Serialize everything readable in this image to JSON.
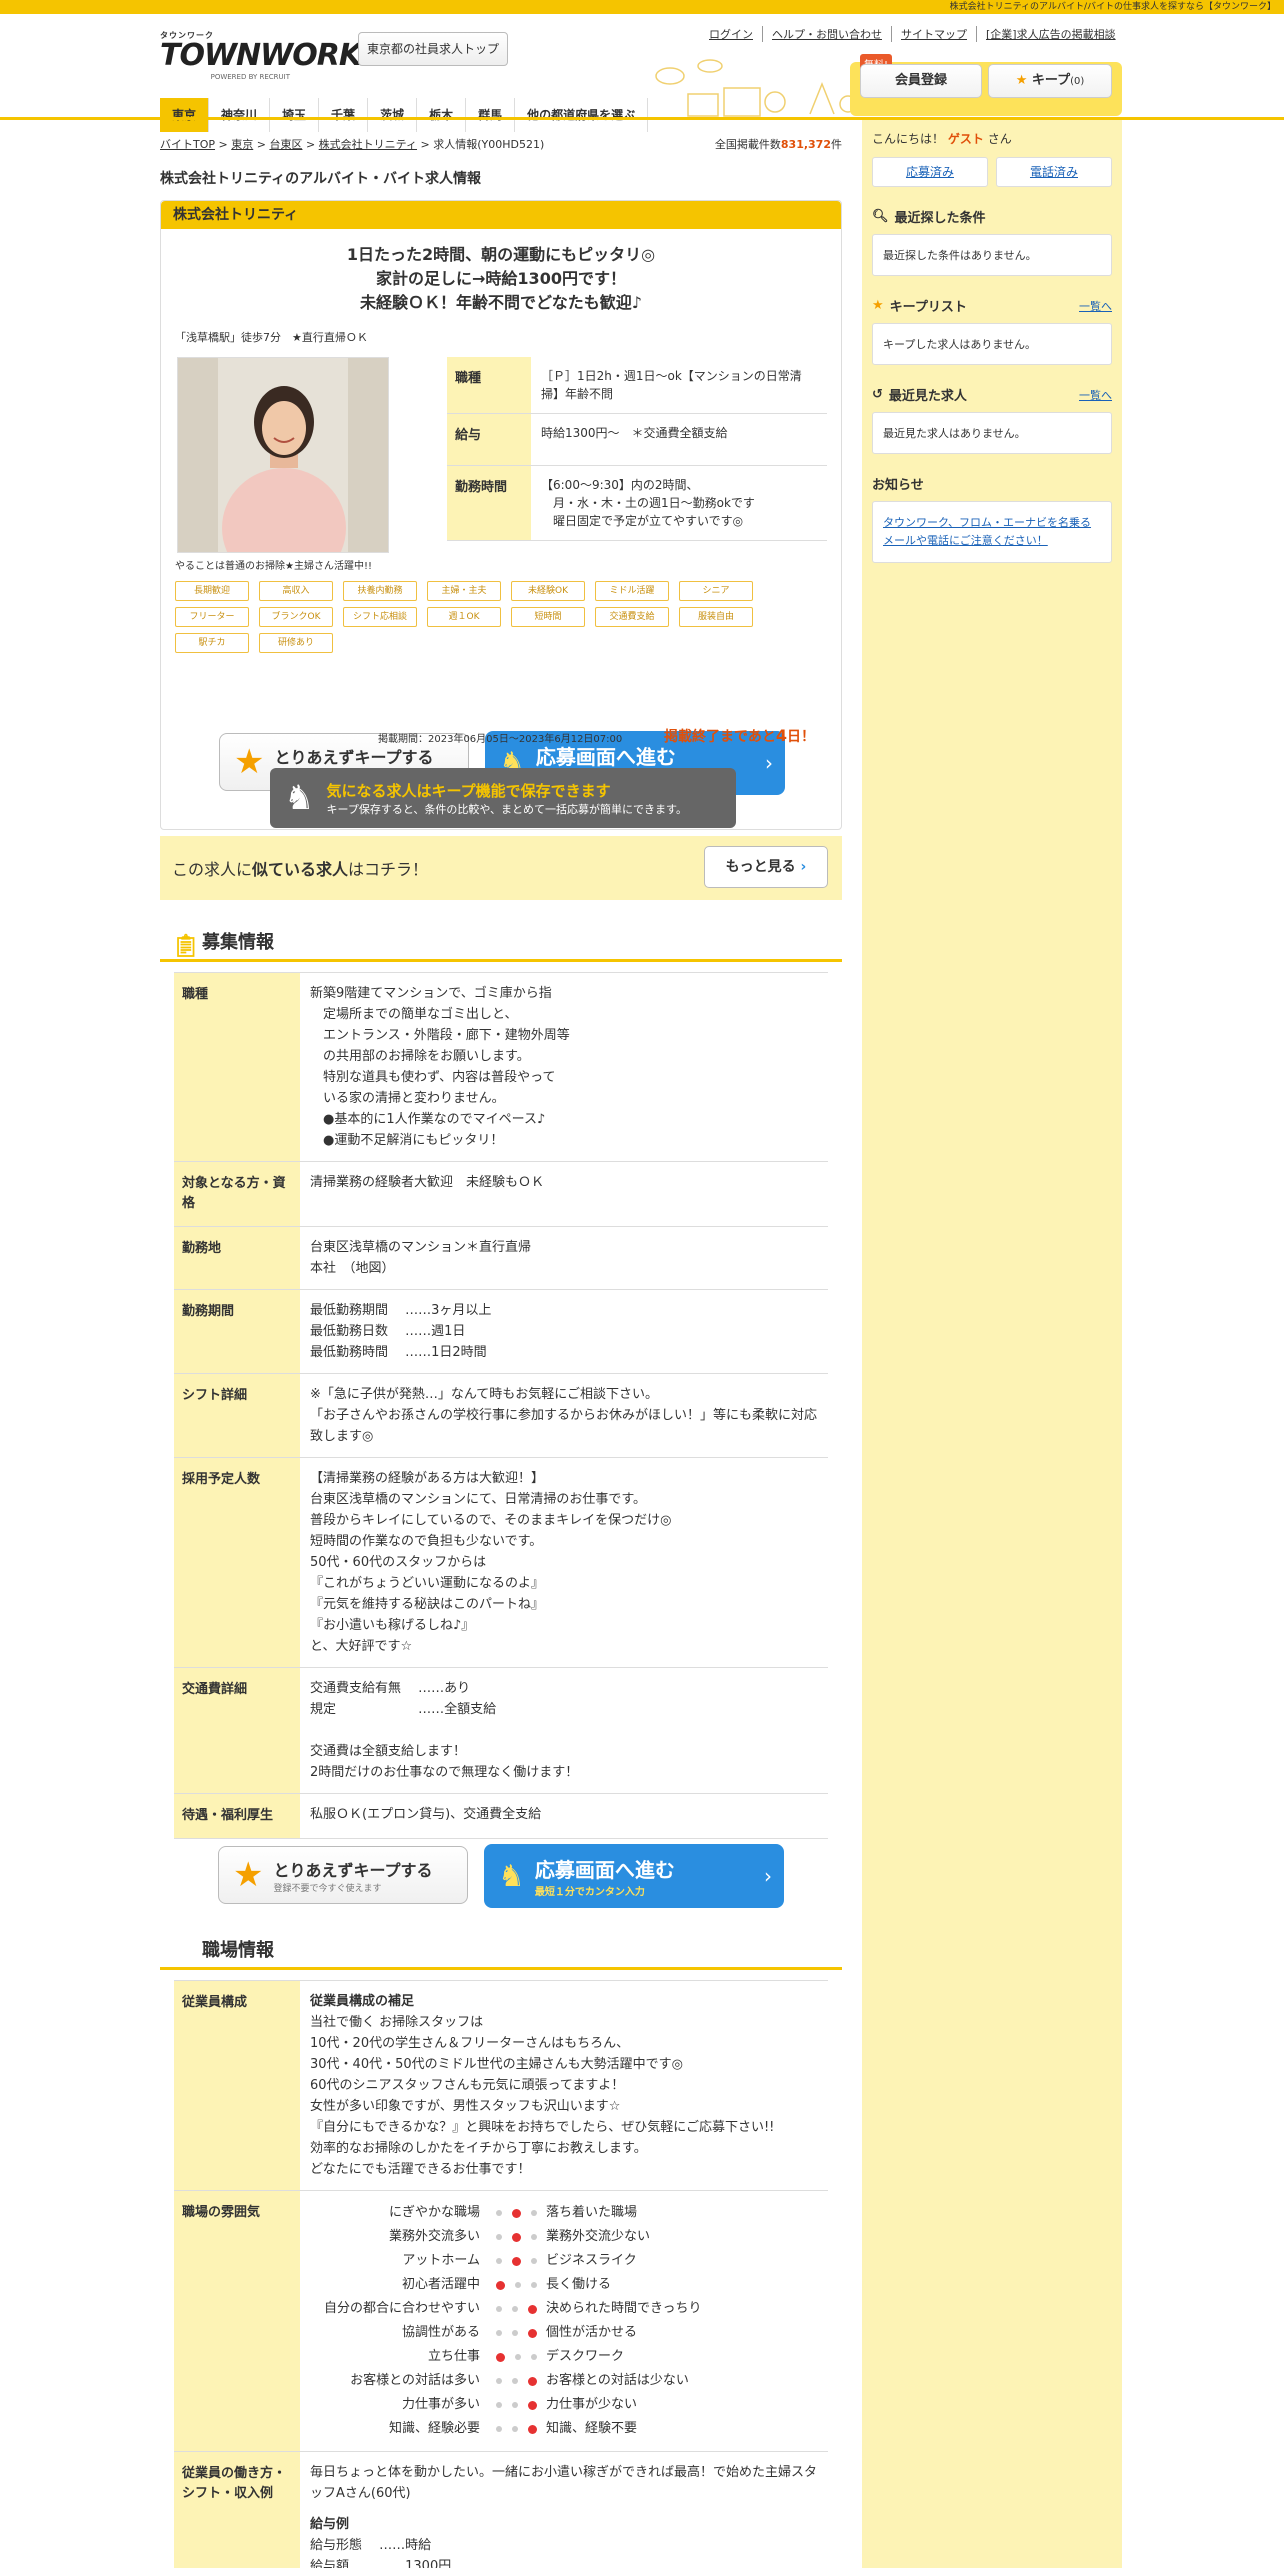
{
  "topbar_text": "株式会社トリニティのアルバイト/バイトの仕事求人を探すなら【タウンワーク】",
  "header": {
    "logo_small": "タウンワーク",
    "logo_big": "TOWNWORK",
    "logo_powered": "POWERED BY RECRUIT",
    "employee_top_button": "東京都の社員求人トップ",
    "links": [
      "ログイン",
      "ヘルプ・お問い合わせ",
      "サイトマップ",
      "[企業]求人広告の掲載相談"
    ],
    "free_tag": "無料!",
    "member_button": "会員登録",
    "keep_button": "キープ",
    "keep_count": "(0)"
  },
  "nav": [
    "東京",
    "神奈川",
    "埼玉",
    "千葉",
    "茨城",
    "栃木",
    "群馬",
    "他の都道府県を選ぶ"
  ],
  "breadcrumb": [
    "バイトTOP",
    "東京",
    "台東区",
    "株式会社トリニティ",
    "求人情報(Y00HD521)"
  ],
  "total_count_label": "全国掲載件数",
  "total_count": "831,372",
  "total_count_unit": "件",
  "page_title": "株式会社トリニティのアルバイト・バイト求人情報",
  "company_name": "株式会社トリニティ",
  "catch_lines": [
    "1日たった2時間、朝の運動にもピッタリ◎",
    "家計の足しに→時給1300円です！",
    "未経験ＯＫ！年齢不問でどなたも歓迎♪"
  ],
  "station": "「浅草橋駅」徒歩7分　★直行直帰ＯＫ",
  "photo_caption": "やることは普通のお掃除★主婦さん活躍中!!",
  "summary": [
    {
      "k": "職種",
      "v": "［Ｐ］1日2h・週1日～ok【マンションの日常清掃】年齢不問"
    },
    {
      "k": "給与",
      "v": "時給1300円～　＊交通費全額支給"
    },
    {
      "k": "勤務時間",
      "v": "【6:00～9:30】内の2時間、\n　月・水・木・土の週1日～勤務okです\n　曜日固定で予定が立てやすいです◎"
    }
  ],
  "tags": [
    "長期歓迎",
    "高収入",
    "扶養内勤務",
    "主婦・主夫",
    "未経験OK",
    "ミドル活躍",
    "シニア",
    "フリーター",
    "ブランクOK",
    "シフト応相談",
    "週１OK",
    "短時間",
    "交通費支給",
    "服装自由",
    "駅チカ",
    "研修あり"
  ],
  "keep_cta": {
    "title": "とりあえずキープする",
    "sub": "登録不要で今すぐ使えます"
  },
  "apply_cta": {
    "title": "応募画面へ進む",
    "sub": "最短１分でカンタン入力"
  },
  "period": "掲載期間：2023年06月05日～2023年6月12日07:00",
  "remain_prefix": "掲載終了まであと",
  "remain_days": "4",
  "remain_suffix": "日！",
  "dark_banner": {
    "title": "気になる求人はキープ機能で保存できます",
    "sub": "キープ保存すると、条件の比較や、まとめて一括応募が簡単にできます。"
  },
  "similar": {
    "pre": "この求人に",
    "bold": "似ている求人",
    "post": "はコチラ！",
    "button": "もっと見る"
  },
  "recruit_section_title": "募集情報",
  "recruit": [
    {
      "k": "職種",
      "v": "新築9階建てマンションで、ゴミ庫から指\n　定場所までの簡単なゴミ出しと、\n　エントランス・外階段・廊下・建物外周等\n　の共用部のお掃除をお願いします。\n　特別な道具も使わず、内容は普段やって\n　いる家の清掃と変わりません。\n　●基本的に1人作業なのでマイペース♪\n　●運動不足解消にもピッタリ！"
    },
    {
      "k": "対象となる方・資格",
      "v": "清掃業務の経験者大歓迎　未経験もＯＫ"
    },
    {
      "k": "勤務地",
      "v": "台東区浅草橋のマンション＊直行直帰\n本社　（地図）"
    },
    {
      "k": "勤務期間",
      "v": "最低勤務期間　 ……3ヶ月以上\n最低勤務日数　 ……週1日\n最低勤務時間　 ……1日2時間"
    },
    {
      "k": "シフト詳細",
      "v": "※「急に子供が発熱…」なんて時もお気軽にご相談下さい。\n「お子さんやお孫さんの学校行事に参加するからお休みがほしい！」等にも柔軟に対応致します◎"
    },
    {
      "k": "採用予定人数",
      "v": "【清掃業務の経験がある方は大歓迎！】\n台東区浅草橋のマンションにて、日常清掃のお仕事です。\n普段からキレイにしているので、そのままキレイを保つだけ◎\n短時間の作業なので負担も少ないです。\n50代・60代のスタッフからは\n『これがちょうどいい運動になるのよ』\n『元気を維持する秘訣はこのパートね』\n『お小遣いも稼げるしね♪』\nと、大好評です☆"
    },
    {
      "k": "交通費詳細",
      "v": "交通費支給有無　 ……あり\n規定　　　　　　 ……全額支給\n\n交通費は全額支給します！\n2時間だけのお仕事なので無理なく働けます！"
    },
    {
      "k": "待遇・福利厚生",
      "v": "私服ＯＫ(エプロン貸与)、交通費全支給"
    }
  ],
  "workplace_section_title": "職場情報",
  "staff": {
    "k": "従業員構成",
    "heading": "従業員構成の補足",
    "v": "当社で働く お掃除スタッフは\n10代・20代の学生さん＆フリーターさんはもちろん、\n30代・40代・50代のミドル世代の主婦さんも大勢活躍中です◎\n60代のシニアスタッフさんも元気に頑張ってますよ！\n女性が多い印象ですが、男性スタッフも沢山います☆\n『自分にもできるかな？』と興味をお持ちでしたら、ぜひ気軽にご応募下さい!!\n効率的なお掃除のしかたをイチから丁寧にお教えします。\nどなたにでも活躍できるお仕事です！"
  },
  "atmosphere": {
    "k": "職場の雰囲気",
    "rows": [
      {
        "left": "にぎやかな職場",
        "right": "落ち着いた職場",
        "pos": 2
      },
      {
        "left": "業務外交流多い",
        "right": "業務外交流少ない",
        "pos": 2
      },
      {
        "left": "アットホーム",
        "right": "ビジネスライク",
        "pos": 2
      },
      {
        "left": "初心者活躍中",
        "right": "長く働ける",
        "pos": 1
      },
      {
        "left": "自分の都合に合わせやすい",
        "right": "決められた時間できっちり",
        "pos": 3
      },
      {
        "left": "協調性がある",
        "right": "個性が活かせる",
        "pos": 3
      },
      {
        "left": "立ち仕事",
        "right": "デスクワーク",
        "pos": 1
      },
      {
        "left": "お客様との対話は多い",
        "right": "お客様との対話は少ない",
        "pos": 3
      },
      {
        "left": "力仕事が多い",
        "right": "力仕事が少ない",
        "pos": 3
      },
      {
        "left": "知識、経験必要",
        "right": "知識、経験不要",
        "pos": 3
      }
    ]
  },
  "style": {
    "k": "従業員の働き方・シフト・収入例",
    "v": "毎日ちょっと体を動かしたい。一緒にお小遣い稼ぎができれば最高！で始めた主婦スタッフAさん(60代)",
    "example_heading": "給与例",
    "example": "給与形態　 ……時給\n給与額　　 ……1300円"
  },
  "sidebar": {
    "greet_pre": "こんにちは！",
    "guest": "ゲスト",
    "greet_post": "さん",
    "btn_applied": "応募済み",
    "btn_called": "電話済み",
    "recent_search_title": "最近探した条件",
    "recent_search_text": "最近探した条件はありません。",
    "keep_list_title": "キープリスト",
    "keep_list_link": "一覧へ",
    "keep_list_text": "キープした求人はありません。",
    "recent_view_title": "最近見た求人",
    "recent_view_link": "一覧へ",
    "recent_view_text": "最近見た求人はありません。",
    "notice_title": "お知らせ",
    "notice_link": "タウンワーク、フロム・エーナビを名乗るメールや電話にご注意ください！"
  },
  "colors": {
    "brand_yellow": "#f5c400",
    "light_yellow": "#fdf3b5",
    "apply_blue": "#2a8ee0",
    "accent_orange": "#e0500a"
  }
}
